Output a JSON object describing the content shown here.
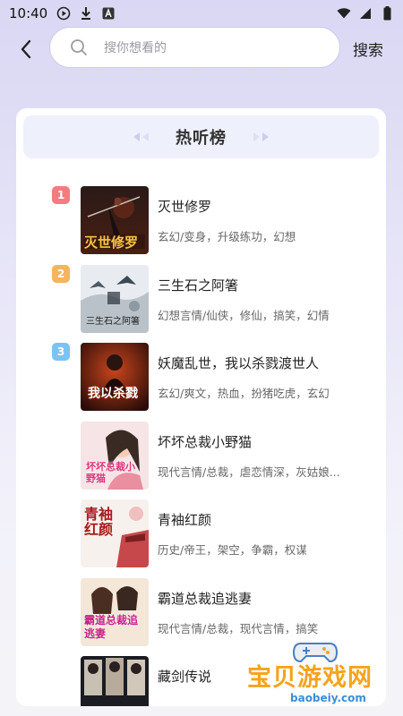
{
  "status_bar": {
    "time": "10:40",
    "left_icons": [
      "play-circle-icon",
      "download-icon",
      "a-box-icon"
    ],
    "right_icons": [
      "wifi-icon",
      "signal-icon",
      "battery-icon"
    ]
  },
  "search": {
    "placeholder": "搜你想看的",
    "submit_label": "搜索"
  },
  "ranking": {
    "title": "热听榜",
    "badge_colors": [
      "#f57b7f",
      "#f6b45c",
      "#7cc3f1"
    ],
    "items": [
      {
        "rank": "1",
        "title": "灭世修罗",
        "tags": "玄幻/变身，升级练功，幻想",
        "cover_text": "灭世修罗"
      },
      {
        "rank": "2",
        "title": "三生石之阿箸",
        "tags": "幻想言情/仙侠，修仙，搞笑，幻情",
        "cover_text": "三生石之阿箸"
      },
      {
        "rank": "3",
        "title": "妖魔乱世，我以杀戮渡世人",
        "tags": "玄幻/爽文，热血，扮猪吃虎，玄幻",
        "cover_text": "我以杀戮"
      },
      {
        "rank": "",
        "title": "坏坏总裁小野猫",
        "tags": "现代言情/总裁，虐恋情深，灰姑娘...",
        "cover_text": "坏坏总裁小野猫"
      },
      {
        "rank": "",
        "title": "青袖红颜",
        "tags": "历史/帝王，架空，争霸，权谋",
        "cover_text": "青袖红颜"
      },
      {
        "rank": "",
        "title": "霸道总裁追逃妻",
        "tags": "现代言情/总裁，现代言情，搞笑",
        "cover_text": "霸道总裁追逃妻"
      },
      {
        "rank": "",
        "title": "藏剑传说",
        "tags": "",
        "cover_text": ""
      }
    ]
  },
  "watermark": {
    "text": "宝贝游戏网",
    "url": "baobeiy.com"
  }
}
